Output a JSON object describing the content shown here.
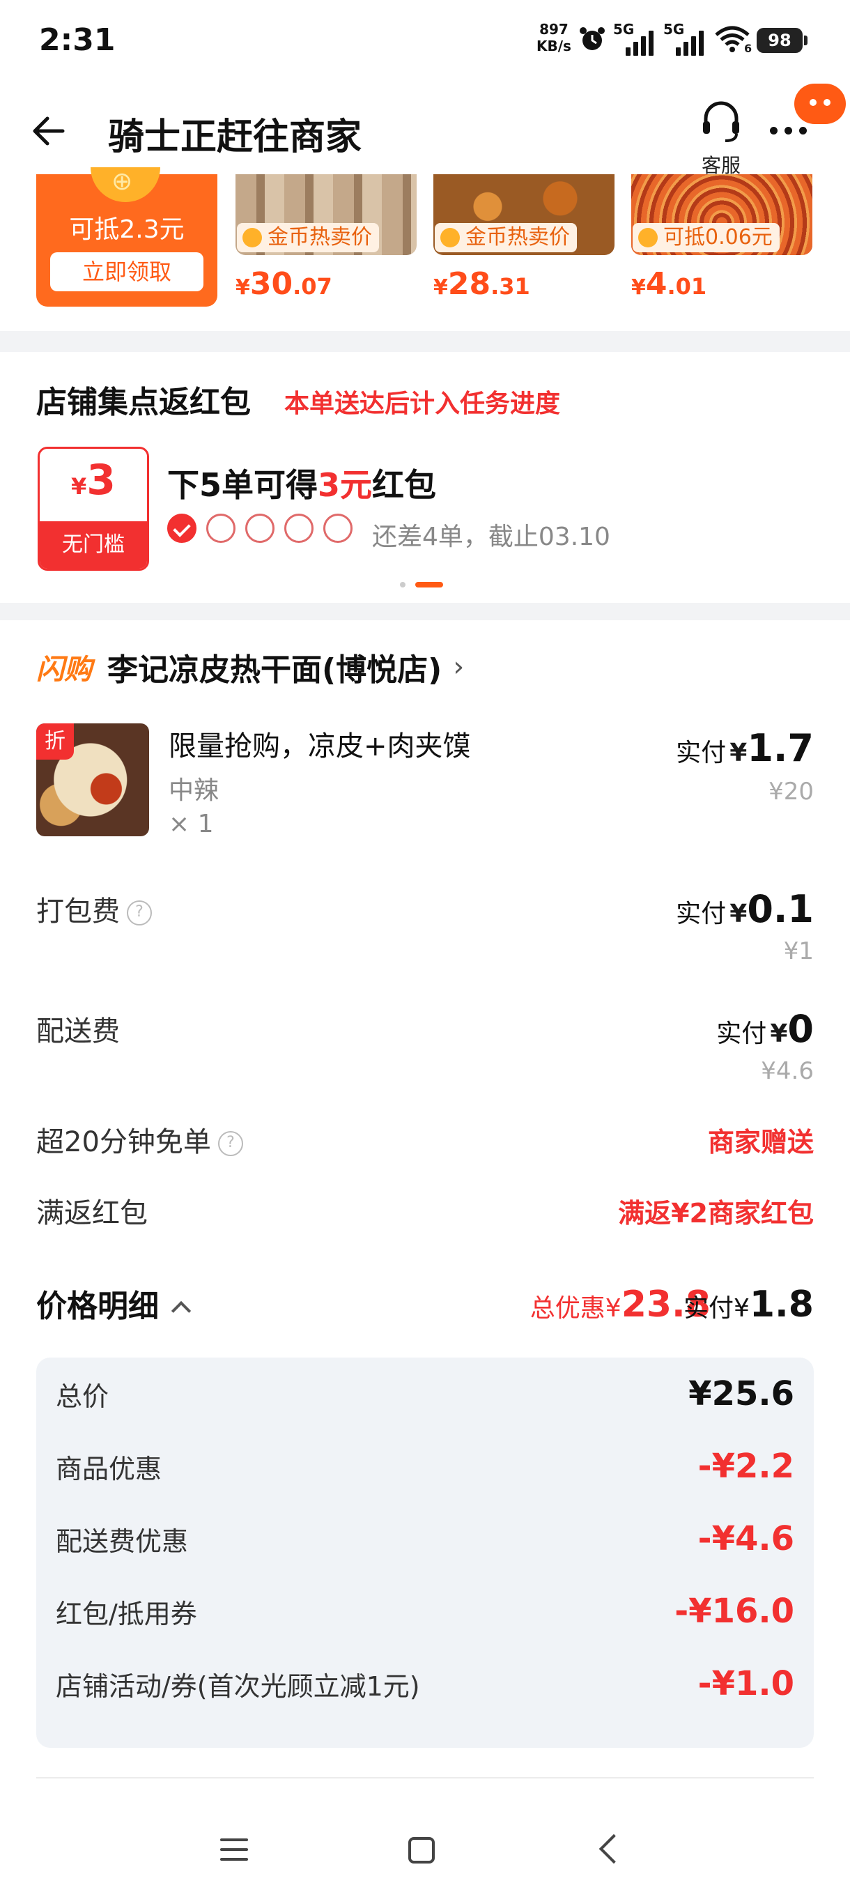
{
  "status_bar": {
    "time": "2:31",
    "net_speed_value": "897",
    "net_speed_unit": "KB/s",
    "signal_1": "5G",
    "signal_2": "5G",
    "wifi_badge": "6",
    "battery": "98"
  },
  "header": {
    "title": "骑士正赶往商家",
    "service_label": "客服"
  },
  "coupon_strip": {
    "redeem_amount": "可抵2.3元",
    "redeem_button": "立即领取",
    "products": [
      {
        "tag": "金币热卖价",
        "currency": "¥",
        "price_main": "30",
        "price_dec": ".07"
      },
      {
        "tag": "金币热卖价",
        "currency": "¥",
        "price_main": "28",
        "price_dec": ".31"
      },
      {
        "tag": "可抵0.06元",
        "currency": "¥",
        "price_main": "4",
        "price_dec": ".01"
      }
    ]
  },
  "shop_points": {
    "title": "店铺集点返红包",
    "subtitle": "本单送达后计入任务进度",
    "ticket_currency": "¥",
    "ticket_amount": "3",
    "ticket_label": "无门槛",
    "goal_prefix": "下5单可得",
    "goal_highlight": "3元",
    "goal_suffix": "红包",
    "progress_done": 1,
    "progress_total": 5,
    "remaining_text": "还差4单，截止03.10"
  },
  "order": {
    "flash_label": "闪购",
    "shop_name": "李记凉皮热干面(博悦店)",
    "item": {
      "badge": "折",
      "name": "限量抢购，凉皮+肉夹馍",
      "spec": "中辣",
      "qty": "× 1",
      "pay_label": "实付",
      "currency": "¥",
      "pay_value": "1.7",
      "original": "¥20"
    },
    "packing": {
      "label": "打包费",
      "help": "?",
      "pay_label": "实付",
      "currency": "¥",
      "pay_value": "0.1",
      "original": "¥1"
    },
    "delivery": {
      "label": "配送费",
      "pay_label": "实付",
      "currency": "¥",
      "pay_value": "0",
      "original": "¥4.6"
    },
    "late_free": {
      "label": "超20分钟免单",
      "help": "?",
      "value": "商家赠送"
    },
    "cashback": {
      "label": "满返红包",
      "value": "满返¥2商家红包"
    },
    "price_detail": {
      "title": "价格明细",
      "total_discount_label": "总优惠",
      "currency": "¥",
      "total_discount": "23.8",
      "pay_label": "实付",
      "pay_value": "1.8",
      "rows": [
        {
          "label": "总价",
          "value": "¥25.6"
        },
        {
          "label": "商品优惠",
          "value": "-¥2.2"
        },
        {
          "label": "配送费优惠",
          "value": "-¥4.6"
        },
        {
          "label": "红包/抵用券",
          "value": "-¥16.0"
        },
        {
          "label": "店铺活动/券(首次光顾立减1元)",
          "value": "-¥1.0"
        }
      ]
    }
  },
  "colors": {
    "accent_orange": "#ff5a14",
    "discount_red": "#f23030",
    "flash_orange": "#ff7a14"
  },
  "icons": [
    "back-arrow-icon",
    "headset-icon",
    "more-icon",
    "chat-bubble-icon",
    "coin-icon",
    "check-icon",
    "chevron-right-icon",
    "chevron-up-icon",
    "help-icon",
    "menu-icon",
    "home-icon",
    "back-icon"
  ]
}
